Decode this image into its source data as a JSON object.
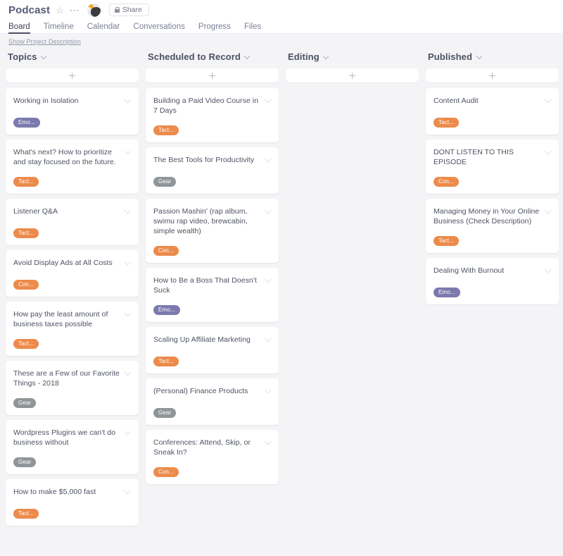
{
  "header": {
    "project_title": "Podcast",
    "star_icon": "star-outline-icon",
    "more_icon": "ellipsis-icon",
    "avatar_name": "avatar",
    "share_label": "Share",
    "lock_icon": "lock-icon"
  },
  "nav": {
    "tabs": [
      {
        "label": "Board",
        "active": true
      },
      {
        "label": "Timeline",
        "active": false
      },
      {
        "label": "Calendar",
        "active": false
      },
      {
        "label": "Conversations",
        "active": false
      },
      {
        "label": "Progress",
        "active": false
      },
      {
        "label": "Files",
        "active": false
      }
    ]
  },
  "board": {
    "description_link": "Show Project Description",
    "add_card_icon": "plus-icon",
    "column_menu_icon": "chevron-down-icon",
    "card_menu_icon": "chevron-down-icon",
    "tag_colors": {
      "orange": "#ec8b4b",
      "purple": "#7b79ad",
      "gray": "#8f9598"
    },
    "columns": [
      {
        "title": "Topics",
        "cards": [
          {
            "title": "Working in Isolation",
            "tags": [
              {
                "label": "Emo...",
                "color": "purple"
              }
            ]
          },
          {
            "title": "What's next? How to prioritize and stay focused on the future.",
            "tags": [
              {
                "label": "Tact...",
                "color": "orange"
              }
            ]
          },
          {
            "title": "Listener Q&A",
            "tags": [
              {
                "label": "Tact...",
                "color": "orange"
              }
            ]
          },
          {
            "title": "Avoid Display Ads at All Costs",
            "tags": [
              {
                "label": "Con...",
                "color": "orange"
              }
            ]
          },
          {
            "title": "How pay the least amount of business taxes possible",
            "tags": [
              {
                "label": "Tact...",
                "color": "orange"
              }
            ]
          },
          {
            "title": "These are a Few of our Favorite Things - 2018",
            "tags": [
              {
                "label": "Gear",
                "color": "gray"
              }
            ]
          },
          {
            "title": "Wordpress Plugins we can't do business without",
            "tags": [
              {
                "label": "Gear",
                "color": "gray"
              }
            ]
          },
          {
            "title": "How to make $5,000 fast",
            "tags": [
              {
                "label": "Tact...",
                "color": "orange"
              }
            ]
          }
        ]
      },
      {
        "title": "Scheduled to Record",
        "cards": [
          {
            "title": "Building a Paid Video Course in 7 Days",
            "tags": [
              {
                "label": "Tact...",
                "color": "orange"
              }
            ]
          },
          {
            "title": "The Best Tools for Productivity",
            "tags": [
              {
                "label": "Gear",
                "color": "gray"
              }
            ]
          },
          {
            "title": "Passion Mashin' (rap album, swimu rap video, brewcabin, simple wealth)",
            "tags": [
              {
                "label": "Con...",
                "color": "orange"
              }
            ]
          },
          {
            "title": "How to Be a Boss That Doesn't Suck",
            "tags": [
              {
                "label": "Emo...",
                "color": "purple"
              }
            ]
          },
          {
            "title": "Scaling Up Affiliate Marketing",
            "tags": [
              {
                "label": "Tact...",
                "color": "orange"
              }
            ]
          },
          {
            "title": "(Personal) Finance Products",
            "tags": [
              {
                "label": "Gear",
                "color": "gray"
              }
            ]
          },
          {
            "title": "Conferences: Attend, Skip, or Sneak In?",
            "tags": [
              {
                "label": "Con...",
                "color": "orange"
              }
            ]
          }
        ]
      },
      {
        "title": "Editing",
        "cards": []
      },
      {
        "title": "Published",
        "cards": [
          {
            "title": "Content Audit",
            "tags": [
              {
                "label": "Tact...",
                "color": "orange"
              }
            ]
          },
          {
            "title": "DONT LISTEN TO THIS EPISODE",
            "tags": [
              {
                "label": "Con...",
                "color": "orange"
              }
            ]
          },
          {
            "title": "Managing Money in Your Online Business (Check Description)",
            "tags": [
              {
                "label": "Tact...",
                "color": "orange"
              }
            ]
          },
          {
            "title": "Dealing With Burnout",
            "tags": [
              {
                "label": "Emo...",
                "color": "purple"
              }
            ]
          }
        ]
      }
    ]
  }
}
